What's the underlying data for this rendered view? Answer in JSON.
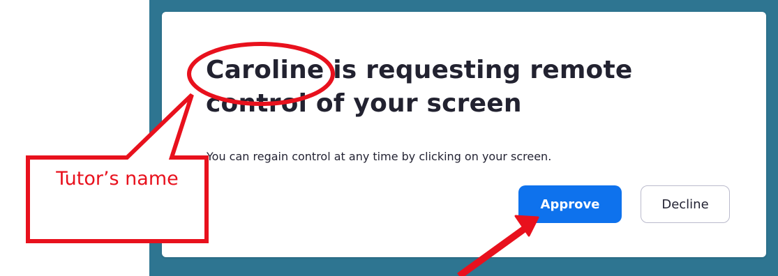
{
  "dialog": {
    "title_name": "Caroline",
    "title_rest_line1": " is requesting remote",
    "title_line2": "control of your screen",
    "subtitle": "You can regain control at any time by clicking on your screen.",
    "approve_label": "Approve",
    "decline_label": "Decline"
  },
  "annotation": {
    "callout_text": "Tutor’s name",
    "color": "#e8111d"
  },
  "colors": {
    "backdrop": "#2e7591",
    "approve_button": "#0e72ed",
    "dialog_background": "#ffffff"
  }
}
